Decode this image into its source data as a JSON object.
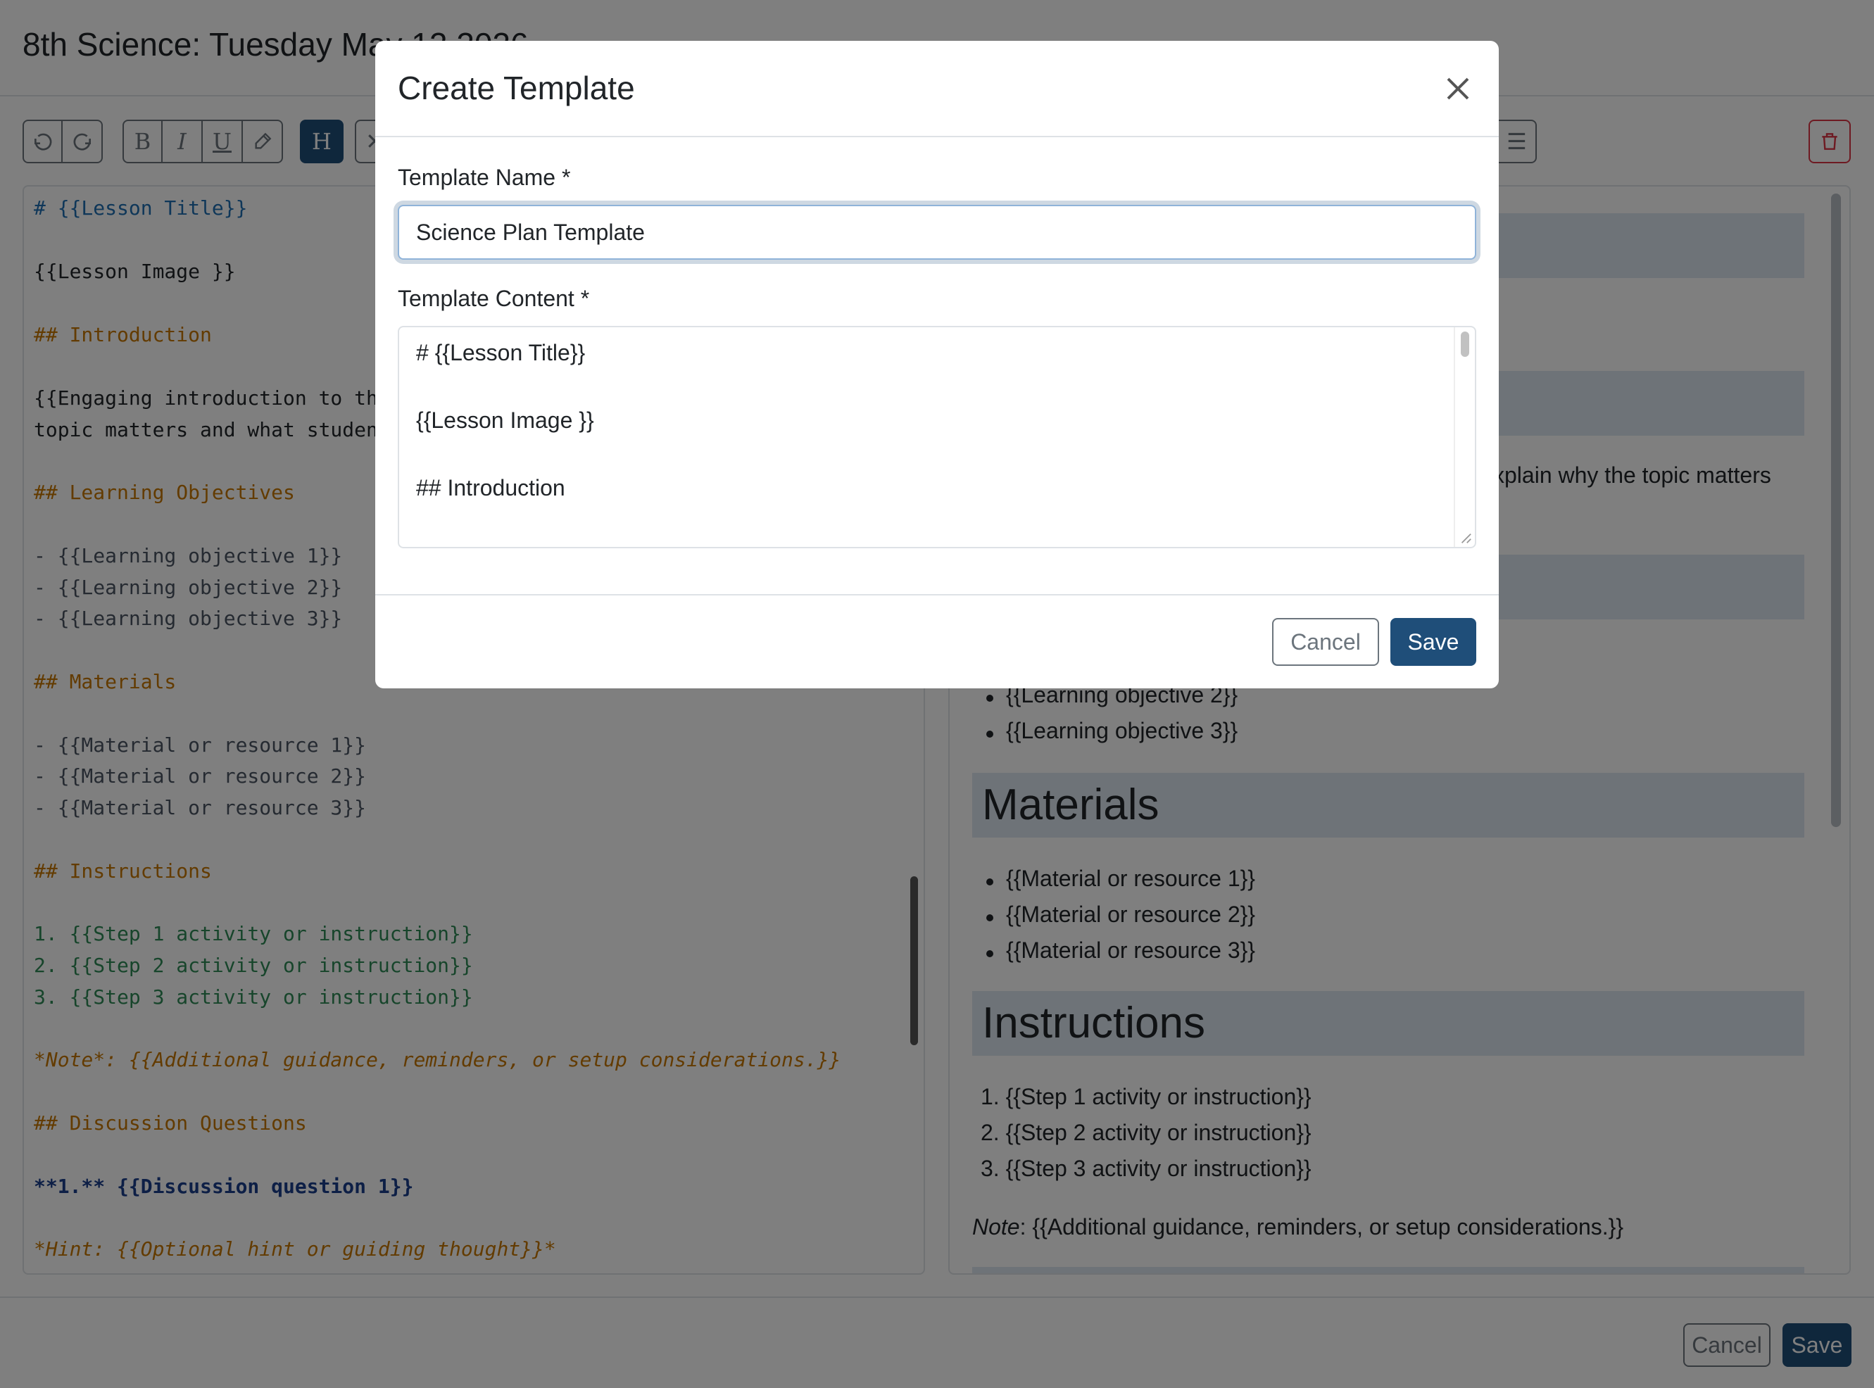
{
  "page": {
    "title": "8th Science: Tuesday May 12 2026"
  },
  "toolbar": {
    "icons": [
      "undo-icon",
      "redo-icon",
      "bold-icon",
      "italic-icon",
      "underline-icon",
      "highlight-icon",
      "heading-icon",
      "trash-icon"
    ],
    "bold_glyph": "B",
    "italic_glyph": "I",
    "underline_glyph": "U",
    "heading_glyph": "H",
    "active_color": "#1f4e79",
    "danger_color": "#dc3545"
  },
  "editor": {
    "lines": [
      "# {{Lesson Title}}",
      "{{Lesson Image }}",
      "## Introduction",
      "{{Engaging introduction to th",
      "topic matters and what studen",
      "## Learning Objectives",
      "- {{Learning objective 1}}",
      "- {{Learning objective 2}}",
      "- {{Learning objective 3}}",
      "## Materials",
      "- {{Material or resource 1}}",
      "- {{Material or resource 2}}",
      "- {{Material or resource 3}}",
      "## Instructions",
      "1. {{Step 1 activity or instruction}}",
      "2. {{Step 2 activity or instruction}}",
      "3. {{Step 3 activity or instruction}}",
      "*Note*: {{Additional guidance, reminders, or setup considerations.}}",
      "## Discussion Questions",
      "**1.** {{Discussion question 1}}",
      "*Hint: {{Optional hint or guiding thought}}*"
    ]
  },
  "preview": {
    "intro_fragment": "xplain why the topic matters",
    "objectives": [
      "{{Learning objective 2}}",
      "{{Learning objective 3}}"
    ],
    "materials_heading": "Materials",
    "materials": [
      "{{Material or resource 1}}",
      "{{Material or resource 2}}",
      "{{Material or resource 3}}"
    ],
    "instructions_heading": "Instructions",
    "steps": [
      "1. {{Step 1 activity or instruction}}",
      "2. {{Step 2 activity or instruction}}",
      "3. {{Step 3 activity or instruction}}"
    ],
    "note_label": "Note",
    "note_text": ": {{Additional guidance, reminders, or setup considerations.}}"
  },
  "footer": {
    "cancel_label": "Cancel",
    "save_label": "Save"
  },
  "modal": {
    "title": "Create Template",
    "name_label": "Template Name *",
    "name_value": "Science Plan Template",
    "content_label": "Template Content *",
    "content_lines": [
      "# {{Lesson Title}}",
      "{{Lesson Image }}",
      "## Introduction"
    ],
    "cancel_label": "Cancel",
    "save_label": "Save"
  }
}
